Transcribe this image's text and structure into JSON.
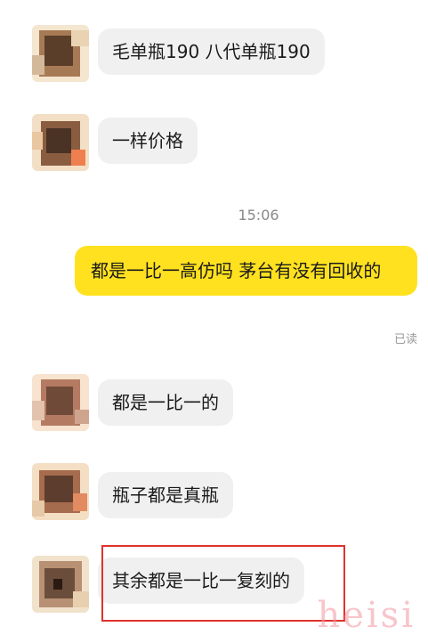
{
  "messages": [
    {
      "from": "other",
      "text": "毛单瓶190 八代单瓶190"
    },
    {
      "from": "other",
      "text": "一样价格"
    },
    {
      "from": "me",
      "text": "都是一比一高仿吗 茅台有没有回收的"
    },
    {
      "from": "other",
      "text": "都是一比一的"
    },
    {
      "from": "other",
      "text": "瓶子都是真瓶"
    },
    {
      "from": "other",
      "text": "其余都是一比一复刻的"
    }
  ],
  "timestamp": "15:06",
  "read_status": "已读",
  "watermark": "heisi",
  "colors": {
    "my_bubble": "#ffe11f",
    "other_bubble": "#f0f0f0",
    "highlight_border": "#e0322d",
    "watermark": "#f096a0"
  }
}
